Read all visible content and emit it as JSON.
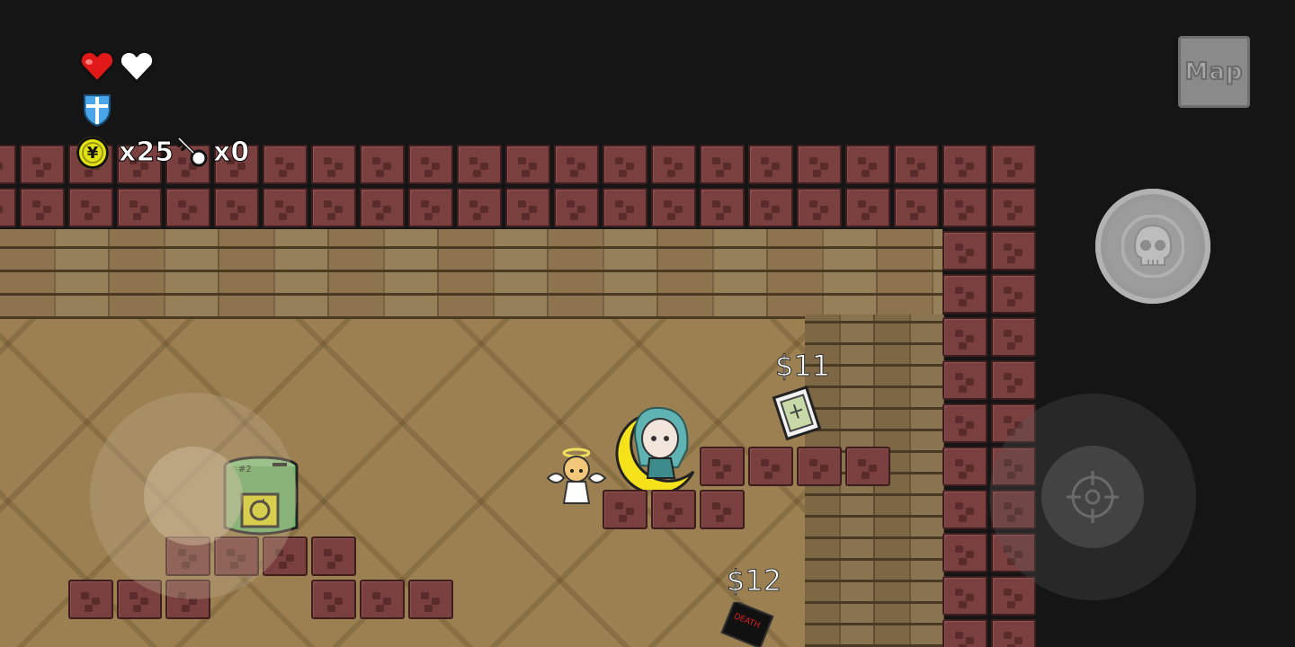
{
  "hud": {
    "hearts": [
      {
        "state": "full",
        "icon": "heart-full-icon",
        "color": "#e01818"
      },
      {
        "state": "empty",
        "icon": "heart-empty-icon",
        "color": "#ffffff"
      }
    ],
    "shield": {
      "icon": "shield-icon",
      "color": "#4aa6e8"
    },
    "coins": {
      "icon": "coin-yen-icon",
      "symbol": "¥",
      "count_label": "x25",
      "color": "#e2e214"
    },
    "keys": {
      "icon": "key-icon",
      "count_label": "x0"
    }
  },
  "controls": {
    "map_button": {
      "label": "Map"
    },
    "skill_button": {
      "icon": "skull-icon"
    },
    "move_joystick": {
      "icon": "joystick"
    },
    "aim_joystick": {
      "icon": "crosshair-icon"
    }
  },
  "shop": {
    "items": [
      {
        "price": "$11",
        "icon": "item-card-icon"
      },
      {
        "price": "$12",
        "icon": "death-book-icon",
        "label": "DEATH"
      }
    ]
  },
  "entities": {
    "player": {
      "icon": "player-character-icon",
      "moon_color": "#f5e21a",
      "hair_color": "#5fb3b3"
    },
    "pet": {
      "icon": "angel-pet-icon"
    },
    "barrel": {
      "icon": "recycle-barrel-icon",
      "label": "#2",
      "color": "#6db86d"
    }
  },
  "colors": {
    "background": "#151515",
    "brick": "#7a3f3f",
    "floor": "#9c8051"
  }
}
